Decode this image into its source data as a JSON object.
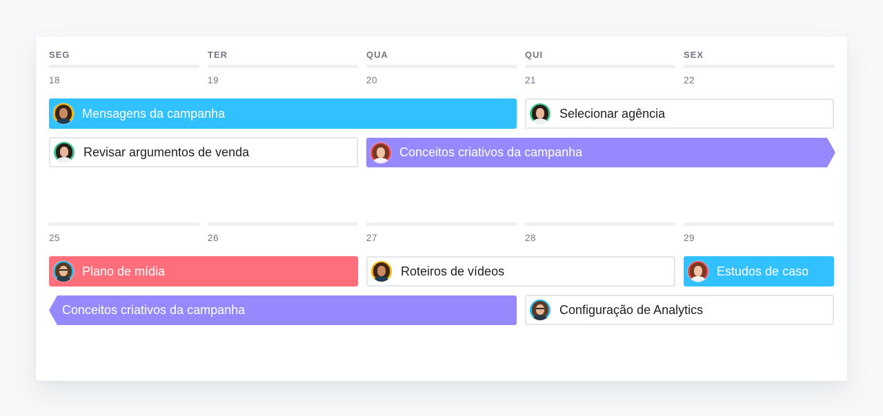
{
  "colors": {
    "blue": "#32c1ff",
    "purple": "#9689ff",
    "red": "#ff6f7b",
    "outline_border": "#e3e6e9"
  },
  "weekdays": [
    "SEG",
    "TER",
    "QUA",
    "QUI",
    "SEX"
  ],
  "week1": {
    "dates": [
      "18",
      "19",
      "20",
      "21",
      "22"
    ],
    "tasks": [
      {
        "label": "Mensagens da campanha",
        "style": "blue",
        "avatar": "woman-yellow-avatar"
      },
      {
        "label": "Selecionar agência",
        "style": "outline",
        "avatar": "woman-green-avatar"
      },
      {
        "label": "Revisar argumentos de venda",
        "style": "outline",
        "avatar": "woman-green-avatar"
      },
      {
        "label": "Conceitos criativos da campanha",
        "style": "purple",
        "avatar": "woman-red-avatar"
      }
    ]
  },
  "week2": {
    "dates": [
      "25",
      "26",
      "27",
      "28",
      "29"
    ],
    "tasks": [
      {
        "label": "Plano de mídia",
        "style": "red",
        "avatar": "man-glasses-avatar"
      },
      {
        "label": "Roteiros de vídeos",
        "style": "outline",
        "avatar": "woman-yellow-avatar"
      },
      {
        "label": "Estudos de caso",
        "style": "blue",
        "avatar": "woman-red-avatar"
      },
      {
        "label": "Conceitos criativos da campanha",
        "style": "purple",
        "avatar": ""
      },
      {
        "label": "Configuração de Analytics",
        "style": "outline",
        "avatar": "man-glasses-avatar"
      }
    ]
  }
}
